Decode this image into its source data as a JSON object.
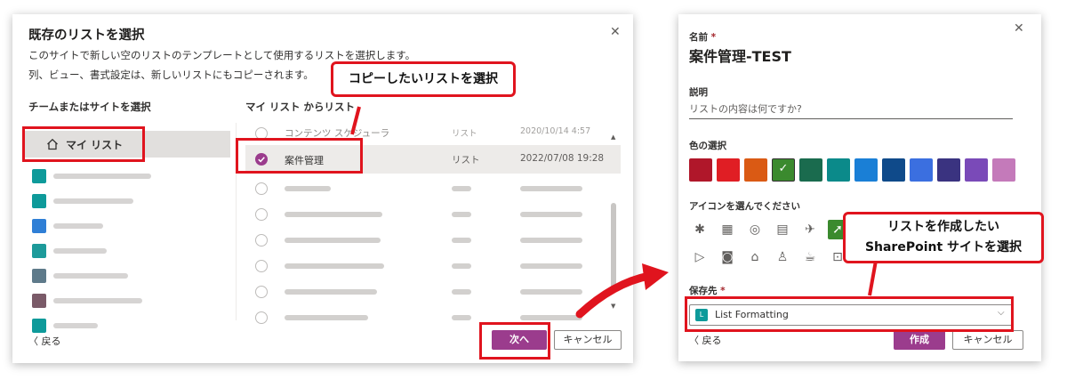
{
  "left_dialog": {
    "title": "既存のリストを選択",
    "description_1": "このサイトで新しい空のリストのテンプレートとして使用するリストを選択します。",
    "description_2": "列、ビュー、書式設定は、新しいリストにもコピーされます。",
    "sites_header": "チームまたはサイトを選択",
    "my_list_label": "マイ リスト",
    "lists_header": "マイ リスト からリスト",
    "partial_top_row": {
      "name": "コンテンツ スケジューラ",
      "type": "リスト",
      "date": "2020/10/14 4:57"
    },
    "selected_row": {
      "name": "案件管理",
      "type": "リスト",
      "date": "2022/07/08 19:28"
    },
    "back_label": "戻る",
    "next_label": "次へ",
    "cancel_label": "キャンセル",
    "site_colors": [
      "#0e9a9a",
      "#0e9a9a",
      "#2f7fd6",
      "#1d9a9a",
      "#5e7a8a",
      "#7a5a68",
      "#0e9a9a"
    ]
  },
  "right_dialog": {
    "name_label": "名前",
    "required_mark": "*",
    "name_value": "案件管理-TEST",
    "description_label": "説明",
    "description_placeholder": "リストの内容は何ですか?",
    "color_label": "色の選択",
    "colors": [
      "#b0172a",
      "#e01e24",
      "#da5a14",
      "#3b8a2e",
      "#1a6b4e",
      "#0b8a8a",
      "#1a7fd6",
      "#0f4a8a",
      "#3b6fe0",
      "#3a3380",
      "#7a4ab8",
      "#c47aba"
    ],
    "selected_color_index": 3,
    "icon_label": "アイコンを選んでください",
    "location_label": "保存先",
    "location_value": "List Formatting",
    "location_icon_letter": "L",
    "back_label": "戻る",
    "create_label": "作成",
    "cancel_label": "キャンセル"
  },
  "callouts": {
    "copy_list": "コピーしたいリストを選択",
    "site_line1": "リストを作成したい",
    "site_line2": "SharePoint サイトを選択"
  },
  "accent_color": "#9b3c8d",
  "highlight_color": "#e0141e"
}
